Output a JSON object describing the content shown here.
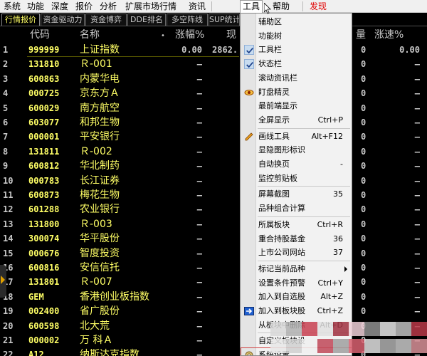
{
  "menubar": {
    "items": [
      "系统",
      "功能",
      "深度",
      "报价",
      "分析",
      "扩展市场行情",
      "资讯",
      "工具",
      "帮助",
      "发现"
    ]
  },
  "tabs": [
    "行情报价",
    "资金驱动力",
    "资金博弈",
    "DDE排名",
    "多空阵线",
    "SUP统计"
  ],
  "header": {
    "code": "代码",
    "name": "名称",
    "dot": "•",
    "chg": "涨幅%",
    "cur": "现",
    "vol": "量",
    "spd": "涨速%"
  },
  "rows": [
    {
      "idx": "1",
      "code": "999999",
      "name": "上证指数",
      "chg": "0.00",
      "cur": "2862.",
      "vol": "0",
      "spd": "0.00"
    },
    {
      "idx": "2",
      "code": "131810",
      "name": "Ｒ-001",
      "chg": "–",
      "cur": "",
      "vol": "0",
      "spd": "–"
    },
    {
      "idx": "3",
      "code": "600863",
      "name": "内蒙华电",
      "chg": "–",
      "cur": "",
      "vol": "0",
      "spd": "–"
    },
    {
      "idx": "4",
      "code": "000725",
      "name": "京东方Ａ",
      "chg": "–",
      "cur": "",
      "vol": "0",
      "spd": "–"
    },
    {
      "idx": "5",
      "code": "600029",
      "name": "南方航空",
      "chg": "–",
      "cur": "",
      "vol": "0",
      "spd": "–"
    },
    {
      "idx": "6",
      "code": "603077",
      "name": "和邦生物",
      "chg": "–",
      "cur": "",
      "vol": "0",
      "spd": "–"
    },
    {
      "idx": "7",
      "code": "000001",
      "name": "平安银行",
      "chg": "–",
      "cur": "",
      "vol": "0",
      "spd": "–"
    },
    {
      "idx": "8",
      "code": "131811",
      "name": "Ｒ-002",
      "chg": "–",
      "cur": "",
      "vol": "0",
      "spd": "–"
    },
    {
      "idx": "9",
      "code": "600812",
      "name": "华北制药",
      "chg": "–",
      "cur": "",
      "vol": "0",
      "spd": "–"
    },
    {
      "idx": "10",
      "code": "000783",
      "name": "长江证券",
      "chg": "–",
      "cur": "",
      "vol": "0",
      "spd": "–"
    },
    {
      "idx": "11",
      "code": "600873",
      "name": "梅花生物",
      "chg": "–",
      "cur": "",
      "vol": "0",
      "spd": "–"
    },
    {
      "idx": "12",
      "code": "601288",
      "name": "农业银行",
      "chg": "–",
      "cur": "",
      "vol": "0",
      "spd": "–"
    },
    {
      "idx": "13",
      "code": "131800",
      "name": "Ｒ-003",
      "chg": "–",
      "cur": "",
      "vol": "0",
      "spd": "–"
    },
    {
      "idx": "14",
      "code": "300074",
      "name": "华平股份",
      "chg": "–",
      "cur": "",
      "vol": "0",
      "spd": "–"
    },
    {
      "idx": "15",
      "code": "000676",
      "name": "智度投资",
      "chg": "–",
      "cur": "",
      "vol": "0",
      "spd": "–"
    },
    {
      "idx": "16",
      "code": "600816",
      "name": "安信信托",
      "chg": "–",
      "cur": "",
      "vol": "0",
      "spd": "–"
    },
    {
      "idx": "17",
      "code": "131801",
      "name": "Ｒ-007",
      "chg": "–",
      "cur": "",
      "vol": "0",
      "spd": "–"
    },
    {
      "idx": "18",
      "code": "GEM",
      "name": "香港创业板指数",
      "chg": "–",
      "cur": "",
      "vol": "0",
      "spd": "–"
    },
    {
      "idx": "19",
      "code": "002400",
      "name": "省广股份",
      "chg": "–",
      "cur": "",
      "vol": "0",
      "spd": "–"
    },
    {
      "idx": "20",
      "code": "600598",
      "name": "北大荒",
      "chg": "–",
      "cur": "",
      "vol": "0",
      "spd": "–"
    },
    {
      "idx": "21",
      "code": "000002",
      "name": "万 科Ａ",
      "chg": "–",
      "cur": "",
      "vol": "0",
      "spd": "–"
    },
    {
      "idx": "22",
      "code": "A12",
      "name": "纳斯达克指数",
      "chg": "–",
      "cur": "",
      "vol": "0",
      "spd": "–"
    }
  ],
  "menu": {
    "items": [
      {
        "label": "辅助区",
        "shortcut": "",
        "icon": ""
      },
      {
        "label": "功能树",
        "shortcut": "",
        "icon": ""
      },
      {
        "label": "工具栏",
        "shortcut": "",
        "icon": "check-icon"
      },
      {
        "label": "状态栏",
        "shortcut": "",
        "icon": "check-icon"
      },
      {
        "label": "滚动资讯栏",
        "shortcut": "",
        "icon": ""
      },
      {
        "label": "盯盘精灵",
        "shortcut": "",
        "icon": "eye-icon"
      },
      {
        "label": "最前端显示",
        "shortcut": "",
        "icon": ""
      },
      {
        "label": "全屏显示",
        "shortcut": "Ctrl+P",
        "icon": ""
      },
      {
        "label": "画线工具",
        "shortcut": "Alt+F12",
        "icon": "pencil-icon"
      },
      {
        "label": "显隐图形标识",
        "shortcut": "",
        "icon": ""
      },
      {
        "label": "自动换页",
        "shortcut": "-",
        "icon": ""
      },
      {
        "label": "监控剪贴板",
        "shortcut": "",
        "icon": ""
      },
      {
        "label": "屏幕截图",
        "shortcut": "35",
        "icon": ""
      },
      {
        "label": "品种组合计算",
        "shortcut": "",
        "icon": ""
      },
      {
        "label": "所属板块",
        "shortcut": "Ctrl+R",
        "icon": ""
      },
      {
        "label": "重合持股基金",
        "shortcut": "36",
        "icon": ""
      },
      {
        "label": "上市公司网站",
        "shortcut": "37",
        "icon": ""
      },
      {
        "label": "标记当前品种",
        "shortcut": "",
        "icon": "",
        "submenu": true
      },
      {
        "label": "设置条件预警",
        "shortcut": "Ctrl+Y",
        "icon": ""
      },
      {
        "label": "加入到自选股",
        "shortcut": "Alt+Z",
        "icon": ""
      },
      {
        "label": "加入到板块股",
        "shortcut": "Ctrl+Z",
        "icon": "arrow-right-icon"
      },
      {
        "label": "从板块中删除",
        "shortcut": "Alt+D",
        "icon": ""
      },
      {
        "label": "自定义板块设",
        "shortcut": "",
        "icon": ""
      },
      {
        "label": "系统设置",
        "shortcut": "",
        "icon": "gear-icon"
      }
    ]
  },
  "colors": {
    "code": "#ffff66",
    "text": "#c8c8c8",
    "menubar_red": "#e00000"
  }
}
